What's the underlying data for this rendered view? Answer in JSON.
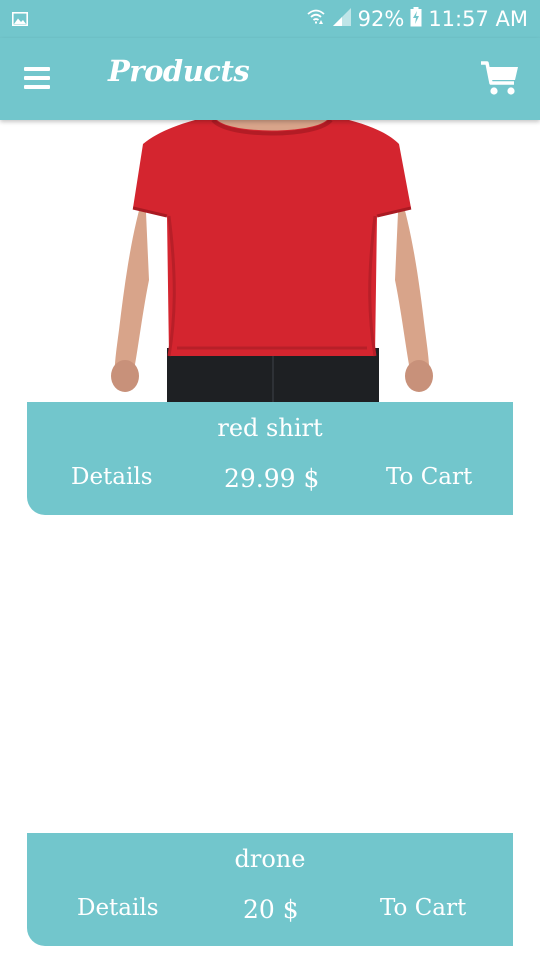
{
  "status_bar": {
    "battery": "92%",
    "time": "11:57 AM",
    "icons": [
      "gallery-notification-icon",
      "wifi-icon",
      "cell-signal-icon",
      "battery-charging-icon"
    ]
  },
  "app_bar": {
    "title": "Products",
    "menu_icon": "hamburger-menu-icon",
    "cart_icon": "shopping-cart-icon",
    "color": "#72c6cc"
  },
  "products": [
    {
      "name": "red shirt",
      "price": "29.99 $",
      "details_label": "Details",
      "cart_label": "To Cart",
      "image": "red-tshirt-photo"
    },
    {
      "name": "drone",
      "price": "20 $",
      "details_label": "Details",
      "cart_label": "To Cart",
      "image": ""
    }
  ]
}
